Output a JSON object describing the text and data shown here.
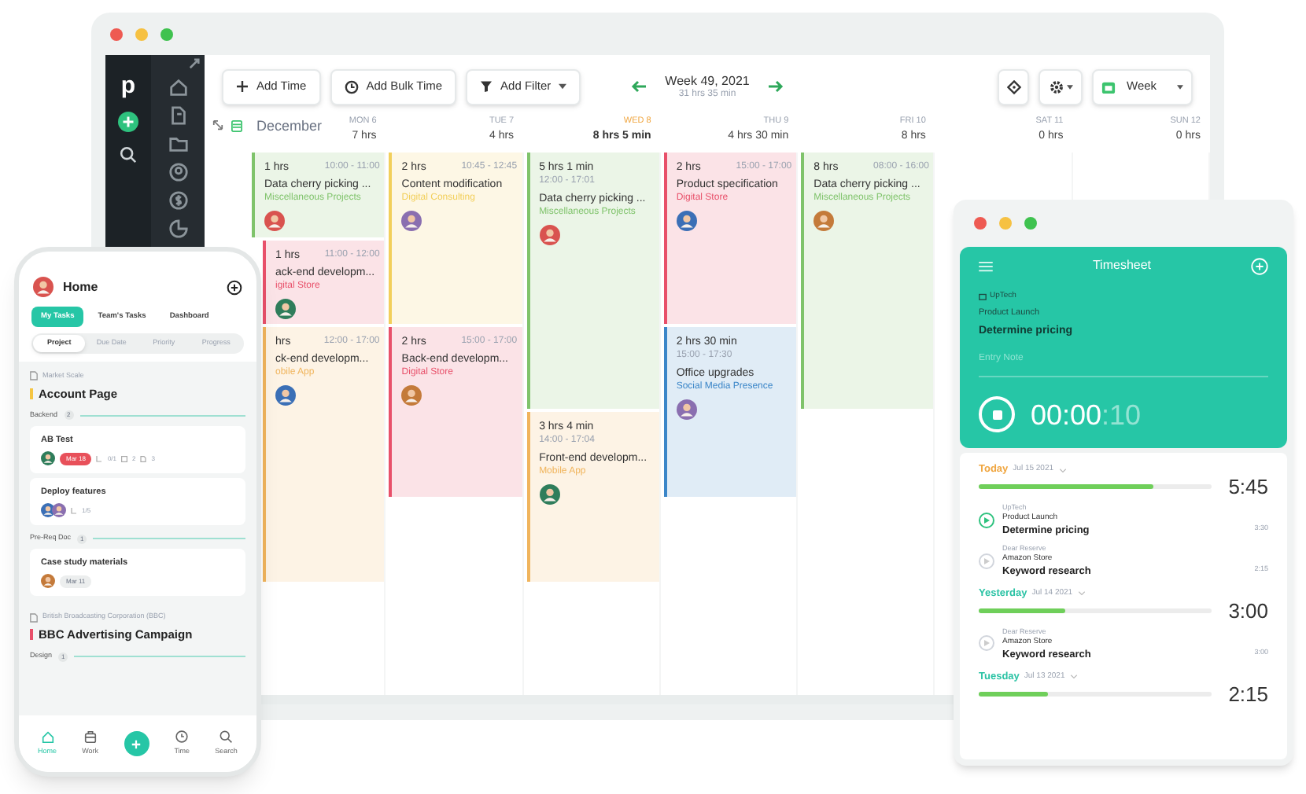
{
  "desktop": {
    "logo": "p",
    "toolbar": {
      "buttons": [
        {
          "kind": "add",
          "label": "Add Time"
        },
        {
          "kind": "bulk",
          "label": "Add Bulk Time"
        },
        {
          "kind": "filter",
          "label": "Add Filter"
        }
      ],
      "week": "Week 49, 2021",
      "week_total": "31 hrs 35 min",
      "view": "Week"
    },
    "month": "December",
    "days": [
      {
        "label": "MON 6",
        "total": "7 hrs",
        "selected": false
      },
      {
        "label": "TUE 7",
        "total": "4 hrs",
        "selected": false
      },
      {
        "label": "WED 8",
        "total": "8 hrs 5 min",
        "selected": true
      },
      {
        "label": "THU 9",
        "total": "4 hrs 30 min",
        "selected": false
      },
      {
        "label": "FRI 10",
        "total": "8 hrs",
        "selected": false
      },
      {
        "label": "SAT 11",
        "total": "0 hrs",
        "selected": false
      },
      {
        "label": "SUN 12",
        "total": "0 hrs",
        "selected": false
      }
    ],
    "columns": [
      [
        {
          "duration": "1 hrs",
          "time": "10:00 - 11:00",
          "title": "Data cherry picking ...",
          "project": "Miscellaneous Projects",
          "color": "#7fc36b"
        },
        {
          "duration": "1 hrs",
          "time": "11:00 - 12:00",
          "title": "ack-end developm...",
          "project": "igital Store",
          "color": "#e8506a"
        },
        {
          "duration": "hrs",
          "time": "12:00 - 17:00",
          "title": "ck-end developm...",
          "project": "obile App",
          "color": "#f0b45c"
        }
      ],
      [
        {
          "duration": "2 hrs",
          "time": "10:45 - 12:45",
          "title": "Content modification",
          "project": "Digital Consulting",
          "color": "#f2cf5b"
        },
        {
          "duration": "2 hrs",
          "time": "15:00 - 17:00",
          "title": "Back-end developm...",
          "project": "Digital Store",
          "color": "#e8506a"
        }
      ],
      [
        {
          "duration": "5 hrs 1 min",
          "time": "12:00 - 17:01",
          "title": "Data cherry picking ...",
          "project": "Miscellaneous Projects",
          "color": "#7fc36b"
        },
        {
          "duration": "3 hrs 4 min",
          "time": "14:00 - 17:04",
          "title": "Front-end developm...",
          "project": "Mobile App",
          "color": "#f0b45c"
        }
      ],
      [
        {
          "duration": "2 hrs",
          "time": "15:00 - 17:00",
          "title": "Product specification",
          "project": "Digital Store",
          "color": "#e8506a"
        },
        {
          "duration": "2 hrs 30 min",
          "time": "15:00 - 17:30",
          "title": "Office upgrades",
          "project": "Social Media Presence",
          "color": "#3b86c8"
        }
      ],
      [
        {
          "duration": "8 hrs",
          "time": "08:00 - 16:00",
          "title": "Data cherry picking ...",
          "project": "Miscellaneous Projects",
          "color": "#7fc36b"
        }
      ]
    ]
  },
  "phone": {
    "title": "Home",
    "tabs": [
      {
        "label": "My Tasks",
        "selected": true
      },
      {
        "label": "Team's Tasks",
        "selected": false
      },
      {
        "label": "Dashboard",
        "selected": false
      }
    ],
    "filters": [
      {
        "label": "Project",
        "selected": true
      },
      {
        "label": "Due Date",
        "selected": false
      },
      {
        "label": "Priority",
        "selected": false
      },
      {
        "label": "Progress",
        "selected": false
      }
    ],
    "projects": [
      {
        "client": "Market Scale",
        "name": "Account Page",
        "color": "#f5c542",
        "sections": [
          {
            "name": "Backend",
            "count": "2",
            "tasks": [
              {
                "title": "AB Test",
                "assignees": [
                  {
                    "kind": "person"
                  }
                ],
                "due": {
                  "text": "Mar 18",
                  "overdue": true
                },
                "subtasks": "0/1",
                "comments": "2",
                "attachments": "3"
              },
              {
                "title": "Deploy features",
                "assignees": [
                  {
                    "kind": "person"
                  },
                  {
                    "kind": "person"
                  }
                ],
                "subtasks": "1/5"
              }
            ]
          },
          {
            "name": "Pre-Req Doc",
            "count": "1",
            "tasks": [
              {
                "title": "Case study materials",
                "assignees": [
                  {
                    "kind": "person"
                  }
                ],
                "due": {
                  "text": "Mar 11",
                  "overdue": false
                }
              }
            ]
          }
        ]
      },
      {
        "client": "British Broadcasting Corporation (BBC)",
        "name": "BBC Advertising Campaign",
        "color": "#e8506a",
        "sections": [
          {
            "name": "Design",
            "count": "1"
          }
        ]
      }
    ],
    "nav": [
      {
        "kind": "home",
        "label": "Home",
        "selected": true
      },
      {
        "kind": "work",
        "label": "Work",
        "selected": false
      },
      {
        "kind": "add",
        "selected": false
      },
      {
        "kind": "time",
        "label": "Time",
        "selected": false
      },
      {
        "kind": "search",
        "label": "Search",
        "selected": false
      }
    ]
  },
  "timesheet": {
    "title": "Timesheet",
    "current": {
      "client": "UpTech",
      "project": "Product Launch",
      "task": "Determine pricing",
      "note_placeholder": "Entry Note",
      "timer": "00:00",
      "timer_seconds": ":10"
    },
    "days": [
      {
        "label": "Today",
        "date": "Jul 15 2021",
        "color": "#f0a640",
        "level": 0.75,
        "total": "5:45",
        "entries": [
          {
            "client": "UpTech",
            "project": "Product Launch",
            "task": "Determine pricing",
            "duration": "3:30",
            "active": true
          },
          {
            "client": "Dear Reserve",
            "project": "Amazon Store",
            "task": "Keyword research",
            "duration": "2:15",
            "active": false
          }
        ]
      },
      {
        "label": "Yesterday",
        "date": "Jul 14 2021",
        "color": "#2cc3a5",
        "level": 0.37,
        "total": "3:00",
        "entries": [
          {
            "client": "Dear Reserve",
            "project": "Amazon Store",
            "task": "Keyword research",
            "duration": "3:00",
            "active": false
          }
        ]
      },
      {
        "label": "Tuesday",
        "date": "Jul 13 2021",
        "color": "#2cc3a5",
        "level": 0.3,
        "total": "2:15"
      }
    ]
  }
}
